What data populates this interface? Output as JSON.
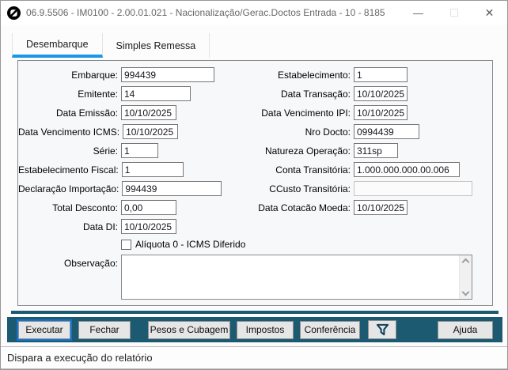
{
  "window": {
    "title": "06.9.5506 - IM0100 - 2.00.01.021 - Nacionalização/Gerac.Doctos Entrada - 10 - 8185",
    "minimize_glyph": "—",
    "close_glyph": "✕"
  },
  "tabs": [
    {
      "label": "Desembarque",
      "active": true
    },
    {
      "label": "Simples Remessa",
      "active": false
    }
  ],
  "form": {
    "left_fields": [
      {
        "key": "embarque",
        "label": "Embarque:",
        "value": "994439",
        "w": 118
      },
      {
        "key": "emitente",
        "label": "Emitente:",
        "value": "14",
        "w": 88
      },
      {
        "key": "data-emissao",
        "label": "Data Emissão:",
        "value": "10/10/2025",
        "w": 70
      },
      {
        "key": "data-vencimento-icms",
        "label": "Data Vencimento ICMS:",
        "value": "10/10/2025",
        "w": 70
      },
      {
        "key": "serie",
        "label": "Série:",
        "value": "1",
        "w": 47
      },
      {
        "key": "estabelecimento-fiscal",
        "label": "Estabelecimento Fiscal:",
        "value": "1",
        "w": 78
      },
      {
        "key": "declaracao-importacao",
        "label": "Declaração Importação:",
        "value": "994439",
        "w": 126
      },
      {
        "key": "total-desconto",
        "label": "Total Desconto:",
        "value": "0,00",
        "w": 70
      },
      {
        "key": "data-di",
        "label": "Data DI:",
        "value": "10/10/2025",
        "w": 70
      }
    ],
    "right_fields": [
      {
        "key": "estabelecimento",
        "label": "Estabelecimento:",
        "value": "1",
        "w": 68
      },
      {
        "key": "data-transacao",
        "label": "Data Transação:",
        "value": "10/10/2025",
        "w": 68
      },
      {
        "key": "data-vencimento-ipi",
        "label": "Data Vencimento IPI:",
        "value": "10/10/2025",
        "w": 68
      },
      {
        "key": "nro-docto",
        "label": "Nro Docto:",
        "value": "0994439",
        "w": 83
      },
      {
        "key": "natureza-operacao",
        "label": "Natureza Operação:",
        "value": "311sp",
        "w": 56
      },
      {
        "key": "conta-transitoria",
        "label": "Conta Transitória:",
        "value": "1.000.000.000.00.006",
        "w": 134
      },
      {
        "key": "ccusto-transitoria",
        "label": "CCusto Transitória:",
        "value": "",
        "w": 150,
        "disabled": true
      },
      {
        "key": "data-cotacao-moeda",
        "label": "Data Cotacão Moeda:",
        "value": "10/10/2025",
        "w": 68
      }
    ],
    "checkbox": {
      "label": "Alíquota 0 - ICMS Diferido",
      "checked": false
    },
    "observacao": {
      "label": "Observação:",
      "value": ""
    }
  },
  "toolbar": {
    "buttons": [
      {
        "label": "Executar",
        "focused": true
      },
      {
        "label": "Fechar"
      },
      {
        "label": "Pesos e Cubagem"
      },
      {
        "label": "Impostos"
      },
      {
        "label": "Conferência"
      }
    ],
    "filter_icon": "funnel",
    "help_label": "Ajuda"
  },
  "statusbar": {
    "text": "Dispara a execução do relatório"
  },
  "colors": {
    "tab_accent": "#1899e8",
    "toolbar_bg": "#1b5a70",
    "focus_ring": "#1473cf",
    "title_icon": "#000000"
  }
}
